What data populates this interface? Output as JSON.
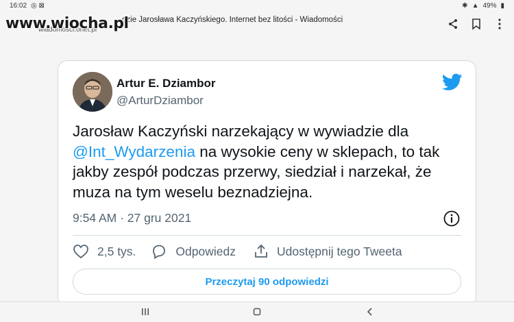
{
  "statusbar": {
    "time": "16:02",
    "battery": "49%"
  },
  "header": {
    "title": "dzie Jarosława Kaczyńskiego. Internet bez litości - Wiadomości",
    "url": "wiadomosci.onet.pl",
    "watermark": "www.wiocha.pl"
  },
  "tweet": {
    "author_name": "Artur E. Dziambor",
    "author_handle": "@ArturDziambor",
    "text_before": "Jarosław Kaczyński narzekający w wywiadzie dla ",
    "mention": "@Int_Wydarzenia",
    "text_after": " na wysokie ceny w sklepach, to tak jakby zespół podczas przerwy, siedział i narzekał, że muza na tym weselu beznadziejna.",
    "timestamp": "9:54 AM · 27 gru 2021",
    "likes": "2,5 tys.",
    "reply_label": "Odpowiedz",
    "share_label": "Udostępnij tego Tweeta",
    "read_replies_label": "Przeczytaj 90 odpowiedzi"
  },
  "colors": {
    "accent": "#1d9bf0",
    "muted": "#536471",
    "text": "#0f1419"
  }
}
